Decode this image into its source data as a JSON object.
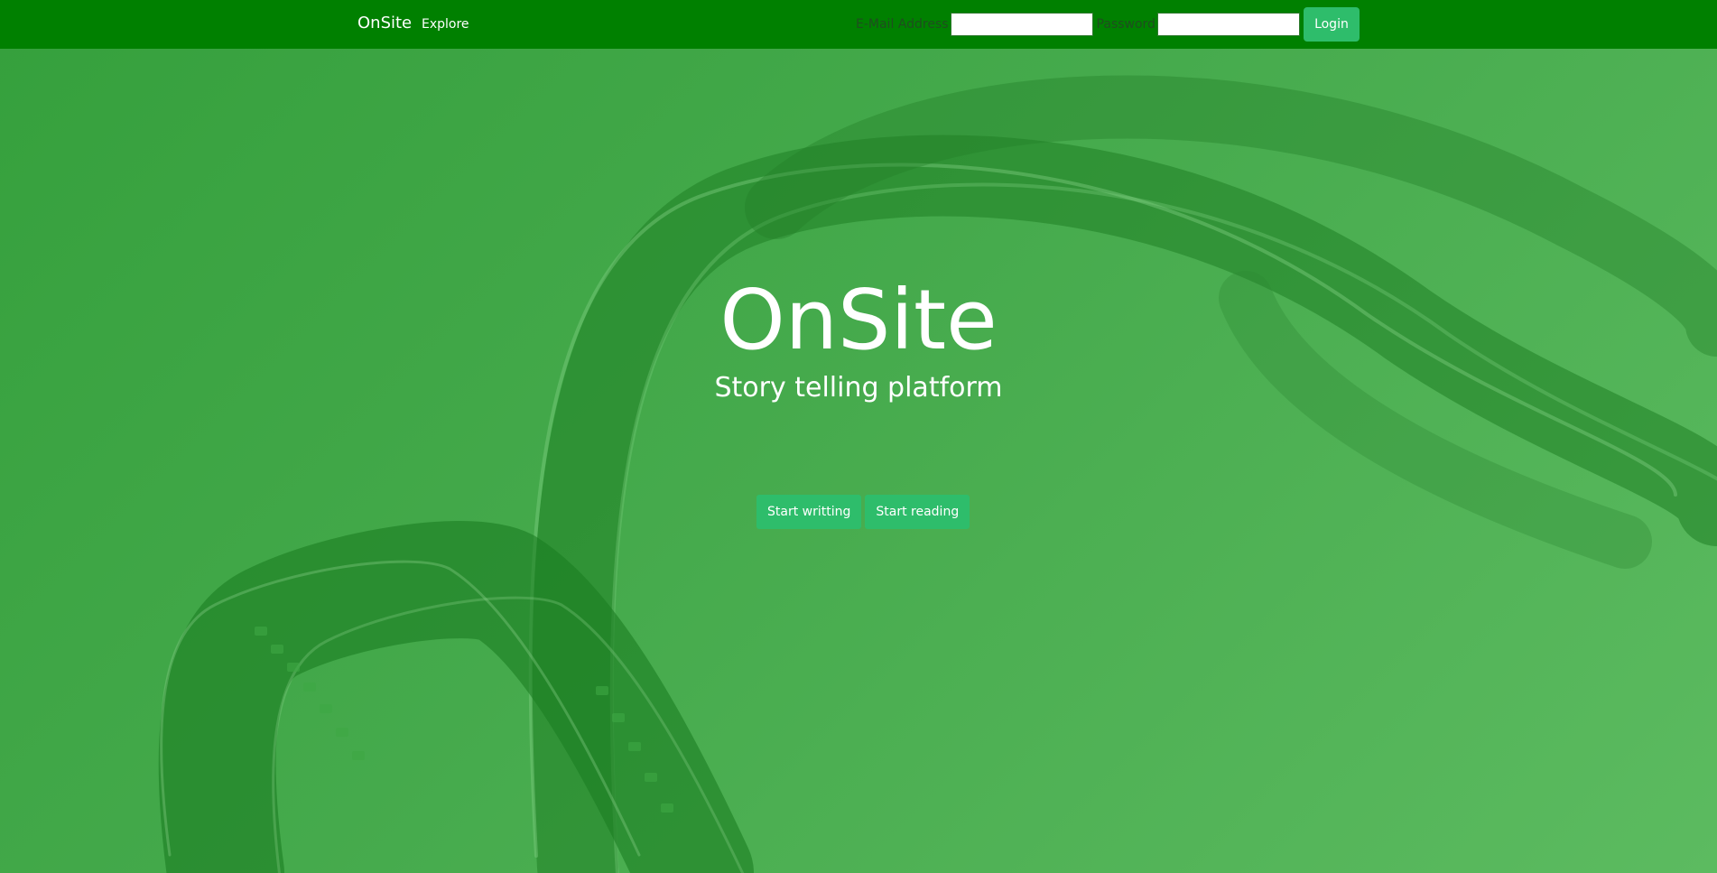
{
  "colors": {
    "navbar": "#008000",
    "hero_green": "#45aa4c",
    "button_green": "#2ebd6b",
    "text_white": "#ffffff"
  },
  "navbar": {
    "brand": "OnSite",
    "explore_link": "Explore",
    "email_label": "E-Mail Address",
    "email_value": "",
    "password_label": "Password",
    "password_value": "",
    "login_button": "Login"
  },
  "hero": {
    "title": "OnSite",
    "subtitle": "Story telling platform",
    "start_writing_button": "Start writting",
    "start_reading_button": "Start reading"
  }
}
